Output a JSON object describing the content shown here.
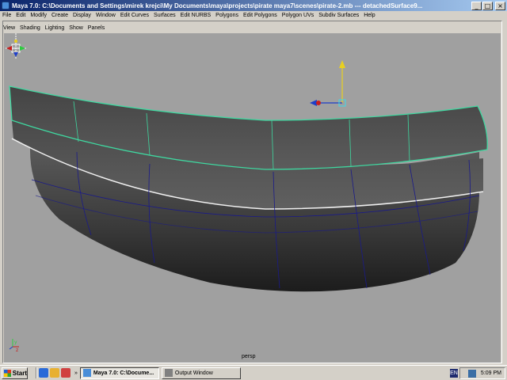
{
  "window": {
    "title": "Maya 7.0: C:\\Documents and Settings\\mirek krejci\\My Documents\\maya\\projects\\pirate maya7\\scenes\\pirate-2.mb  ---  detachedSurface9...",
    "buttons": [
      "_",
      "□",
      "×"
    ]
  },
  "main_menu": [
    "File",
    "Edit",
    "Modify",
    "Create",
    "Display",
    "Window",
    "Edit Curves",
    "Surfaces",
    "Edit NURBS",
    "Polygons",
    "Edit Polygons",
    "Polygon UVs",
    "Subdiv Surfaces",
    "Help"
  ],
  "panel_menu": [
    "View",
    "Shading",
    "Lighting",
    "Show",
    "Panels"
  ],
  "viewport": {
    "camera_label": "persp",
    "background": "#a0a0a0",
    "selected_color": "#3fd8a0",
    "surface_color": "#585858",
    "isoparm_color": "#1a1a8a",
    "axis": {
      "x_color": "#c81e1e",
      "y_color": "#2ecc40",
      "z_color": "#1e3ec8"
    },
    "manipulator_color": "#e8d020"
  },
  "taskbar": {
    "start_label": "Start",
    "quick_launch_more": "»",
    "tasks": [
      {
        "label": "Maya 7.0: C:\\Docume...",
        "active": true
      },
      {
        "label": "Output Window",
        "active": false
      }
    ],
    "language": "EN",
    "clock": "5:09 PM"
  }
}
